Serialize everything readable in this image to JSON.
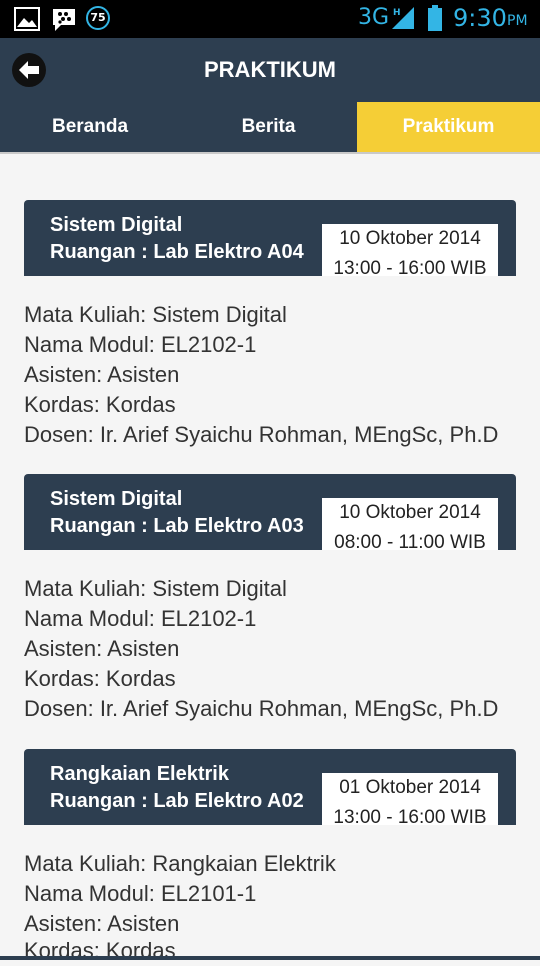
{
  "status_bar": {
    "notification_count": "75",
    "network": "3G",
    "time": "9:30",
    "ampm": "PM",
    "icons": [
      "gallery-icon",
      "bbm-icon",
      "notification-badge-icon",
      "signal-icon",
      "battery-icon"
    ],
    "color": "#33b5e5"
  },
  "app_bar": {
    "title": "PRAKTIKUM",
    "back_icon": "back-arrow-icon",
    "background": "#2d3e50"
  },
  "tabs": [
    {
      "label": "Beranda",
      "active": false
    },
    {
      "label": "Berita",
      "active": false
    },
    {
      "label": "Praktikum",
      "active": true
    }
  ],
  "accent_color": "#f5ce36",
  "schedule": [
    {
      "title": "Sistem Digital",
      "room": "Ruangan : Lab Elektro A04",
      "date": "10 Oktober 2014",
      "time": "13:00 - 16:00 WIB",
      "details": [
        "Mata Kuliah: Sistem Digital",
        "Nama Modul: EL2102-1",
        "Asisten: Asisten",
        "Kordas: Kordas",
        "Dosen: Ir. Arief Syaichu Rohman, MEngSc, Ph.D"
      ]
    },
    {
      "title": "Sistem Digital",
      "room": "Ruangan : Lab Elektro A03",
      "date": "10 Oktober 2014",
      "time": "08:00 - 11:00 WIB",
      "details": [
        "Mata Kuliah: Sistem Digital",
        "Nama Modul: EL2102-1",
        "Asisten: Asisten",
        "Kordas: Kordas",
        "Dosen: Ir. Arief Syaichu Rohman, MEngSc, Ph.D"
      ]
    },
    {
      "title": "Rangkaian Elektrik",
      "room": "Ruangan : Lab Elektro A02",
      "date": "01 Oktober 2014",
      "time": "13:00 - 16:00 WIB",
      "details": [
        "Mata Kuliah: Rangkaian Elektrik",
        "Nama Modul: EL2101-1",
        "Asisten: Asisten",
        "Kordas: Kordas"
      ]
    }
  ]
}
